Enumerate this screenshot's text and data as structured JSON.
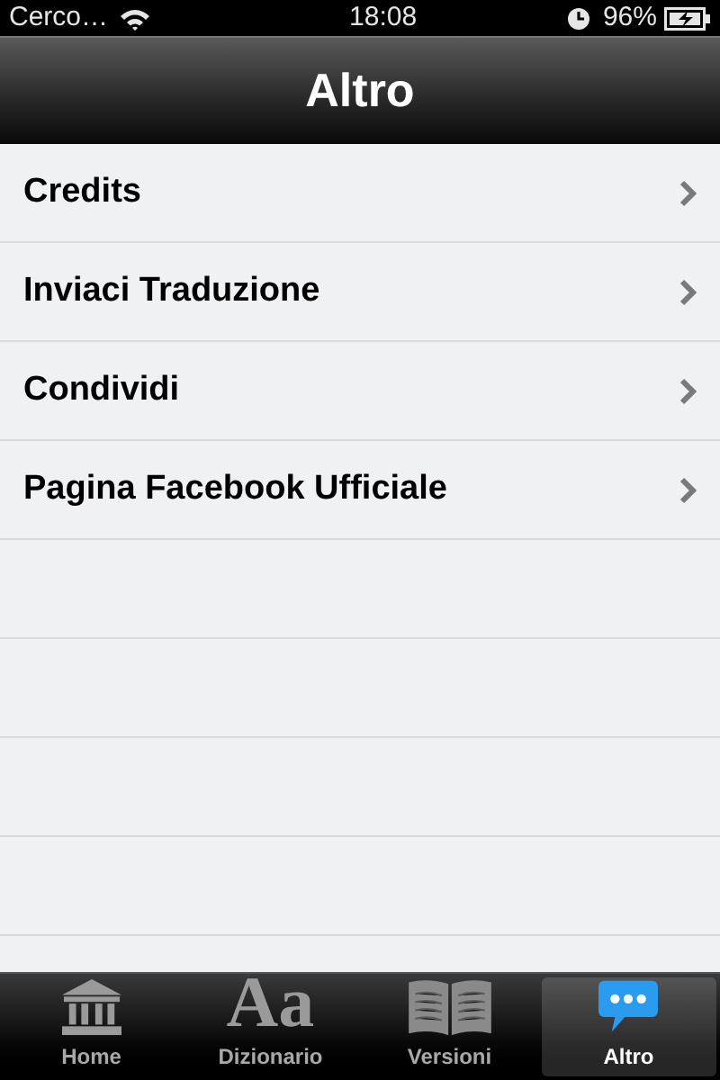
{
  "status_bar": {
    "carrier": "Cerco…",
    "time": "18:08",
    "battery": "96%"
  },
  "nav_bar": {
    "title": "Altro"
  },
  "menu_items": [
    {
      "label": "Credits"
    },
    {
      "label": "Inviaci Traduzione"
    },
    {
      "label": "Condividi"
    },
    {
      "label": "Pagina Facebook Ufficiale"
    }
  ],
  "tab_bar": [
    {
      "label": "Home",
      "kind": "building",
      "selected": false
    },
    {
      "label": "Dizionario",
      "kind": "glyph",
      "glyph": "Aa",
      "selected": false
    },
    {
      "label": "Versioni",
      "kind": "book",
      "selected": false
    },
    {
      "label": "Altro",
      "kind": "chat",
      "selected": true
    }
  ]
}
